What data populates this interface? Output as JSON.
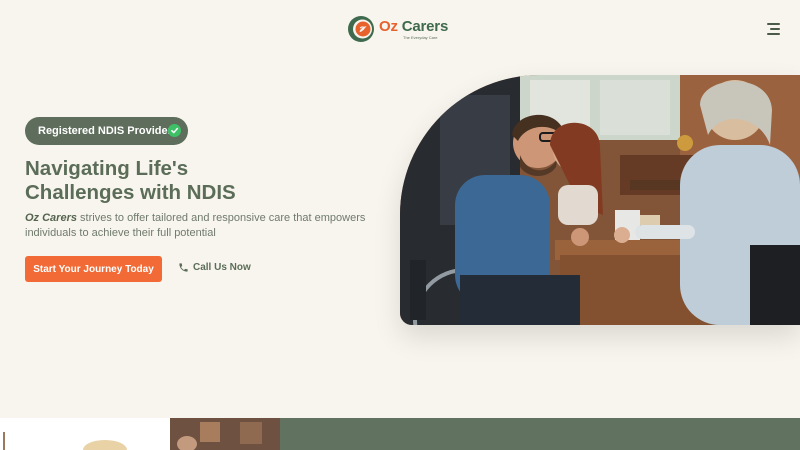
{
  "header": {
    "logo": {
      "name_part1": "Oz",
      "name_part2": "Carers",
      "tagline": "The Everyday Care"
    },
    "menu_icon": "hamburger-menu-icon"
  },
  "hero": {
    "badge": {
      "label": "Registered NDIS Provider",
      "icon": "check-circle-icon"
    },
    "title_line1": "Navigating Life's",
    "title_line2": "Challenges with NDIS",
    "description_brand": "Oz Carers",
    "description_rest": " strives to offer tailored and responsive care that empowers individuals to achieve their full potential",
    "primary_button": "Start Your Journey Today",
    "secondary_link": {
      "label": "Call Us Now",
      "icon": "phone-icon"
    }
  },
  "colors": {
    "background": "#f8f5ee",
    "primary_text": "#5b6d59",
    "accent_orange": "#f26a35",
    "brand_green": "#3f6a4e",
    "badge_bg": "#5f6e5c",
    "check_green": "#3ec067",
    "section_green": "#627260"
  }
}
